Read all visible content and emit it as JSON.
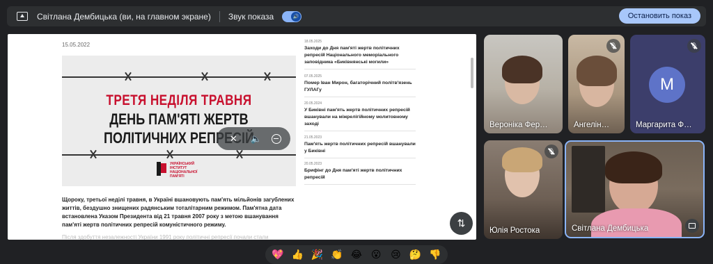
{
  "presenting_bar": {
    "title": "Світлана Дембицька (ви, на главном экране)",
    "sound_label": "Звук показа",
    "sound_on": true,
    "stop_button": "Остановить показ"
  },
  "shared_page": {
    "date": "15.05.2022",
    "banner": {
      "line1": "ТРЕТЯ НЕДІЛЯ ТРАВНЯ",
      "line2": "ДЕНЬ ПАМ'ЯТІ ЖЕРТВ",
      "line3": "ПОЛІТИЧНИХ РЕПРЕСІЙ",
      "institute": "УКРАЇНСЬКИЙ ІНСТИТУТ НАЦІОНАЛЬНОЇ ПАМ'ЯТІ"
    },
    "article_text": "Щороку, третьої неділі травня, в Україні вшановують пам'ять мільйонів загублених життів, бездушно знищених радянським тоталітарним режимом. Пам'ятна дата встановлена Указом Президента від 21 травня 2007 року з метою вшанування пам'яті жертв політичних репресій комуністичного режиму.",
    "article_text_2": "Після здобуття незалежності України 1991 року політичні репресії почали стали визнаватись",
    "news": [
      {
        "date": "18.05.2025",
        "title": "Заходи до Дня пам'яті жертв політичних репресій Національного меморіального заповідника «Биківнянські могили»"
      },
      {
        "date": "07.05.2025",
        "title": "Помер Іван Мирон, багаторічний політв'язень ГУЛАГу"
      },
      {
        "date": "20.05.2024",
        "title": "У Биківні пам'ять жертв політичних репресій вшанували на міжрелігійному молитовному заході"
      },
      {
        "date": "21.05.2023",
        "title": "Пам'ять жертв політичних репресій вшанували у Биківні"
      },
      {
        "date": "20.05.2023",
        "title": "Брифінг до Дня пам'яті жертв політичних репресій"
      }
    ]
  },
  "participants": [
    {
      "name": "Вероніка Фер…",
      "muted": false
    },
    {
      "name": "Ангелін…",
      "muted": true
    },
    {
      "name": "Маргарита Ф…",
      "muted": true,
      "initial": "M",
      "avatar_color": "#5e73c8"
    },
    {
      "name": "Юлія Ростока",
      "muted": true
    },
    {
      "name": "Світлана Дембицька",
      "muted": false,
      "active_speaker": true
    }
  ],
  "reactions": [
    "💖",
    "👍",
    "🎉",
    "👏",
    "😂",
    "😮",
    "😢",
    "🤔",
    "👎"
  ],
  "colors": {
    "background": "#202124",
    "accent": "#8ab4f8",
    "stop_button": "#a8c7fa",
    "banner_red": "#c8102e"
  }
}
